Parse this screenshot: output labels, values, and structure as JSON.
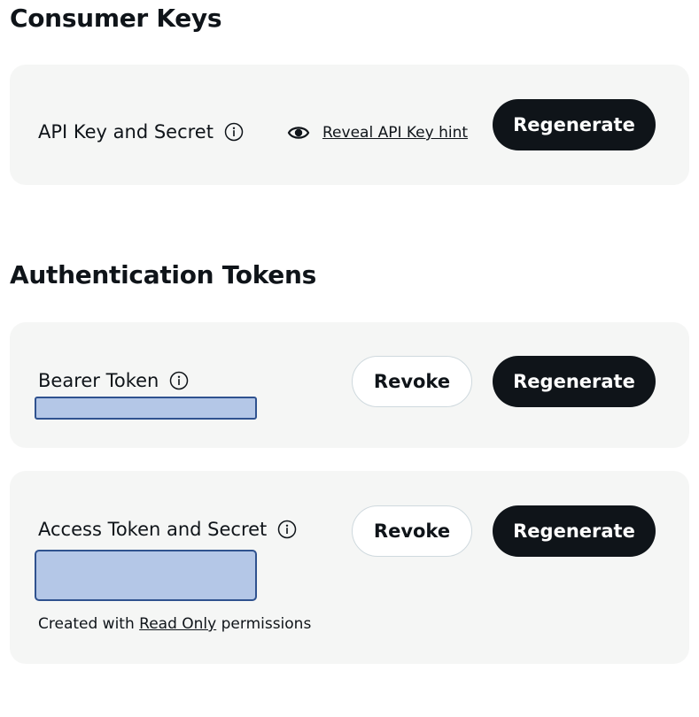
{
  "consumer_keys": {
    "title": "Consumer Keys",
    "api_key_label": "API Key and Secret",
    "info_icon": "info-circle-icon",
    "reveal_icon": "eye-icon",
    "reveal_link": "Reveal API Key hint",
    "regenerate_label": "Regenerate"
  },
  "auth_tokens": {
    "title": "Authentication Tokens",
    "bearer": {
      "label": "Bearer Token",
      "revoke_label": "Revoke",
      "regenerate_label": "Regenerate"
    },
    "access": {
      "label": "Access Token and Secret",
      "revoke_label": "Revoke",
      "regenerate_label": "Regenerate",
      "note_prefix": "Created with ",
      "note_link": "Read Only",
      "note_suffix": " permissions"
    }
  },
  "colors": {
    "card_background": "#f5f6f5",
    "button_dark": "#0f1419",
    "redaction_fill": "#b4c7e7",
    "redaction_border": "#2f528f"
  }
}
